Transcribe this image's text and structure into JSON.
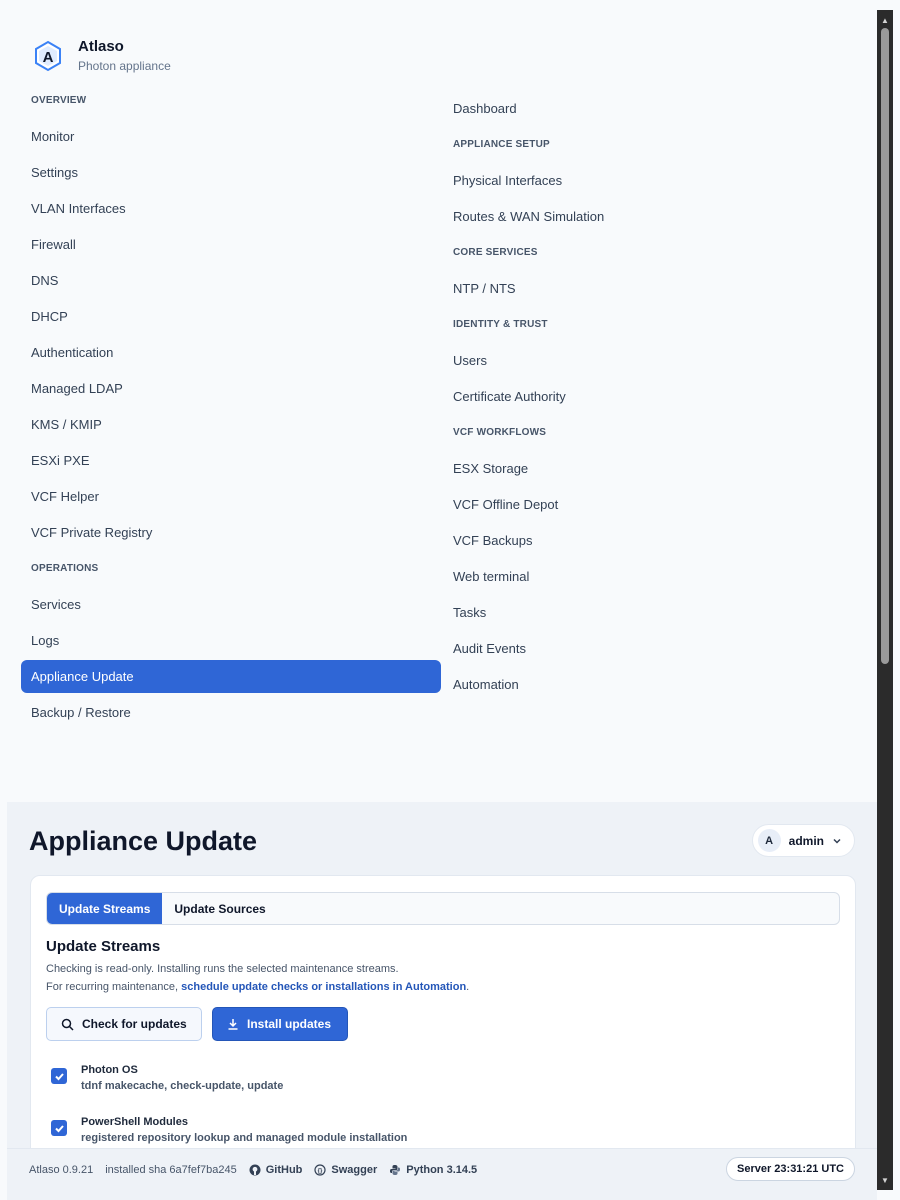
{
  "brand": {
    "name": "Atlaso",
    "subtitle": "Photon appliance",
    "logo_icon": "atlaso-logo-icon"
  },
  "nav_left": [
    {
      "type": "section",
      "label": "OVERVIEW"
    },
    {
      "type": "item",
      "label": "Monitor"
    },
    {
      "type": "item",
      "label": "Settings"
    },
    {
      "type": "item",
      "label": "VLAN Interfaces"
    },
    {
      "type": "item",
      "label": "Firewall"
    },
    {
      "type": "item",
      "label": "DNS"
    },
    {
      "type": "item",
      "label": "DHCP"
    },
    {
      "type": "item",
      "label": "Authentication"
    },
    {
      "type": "item",
      "label": "Managed LDAP"
    },
    {
      "type": "item",
      "label": "KMS / KMIP"
    },
    {
      "type": "item",
      "label": "ESXi PXE"
    },
    {
      "type": "item",
      "label": "VCF Helper"
    },
    {
      "type": "item",
      "label": "VCF Private Registry"
    },
    {
      "type": "section",
      "label": "OPERATIONS"
    },
    {
      "type": "item",
      "label": "Services"
    },
    {
      "type": "item",
      "label": "Logs"
    },
    {
      "type": "item",
      "label": "Appliance Update",
      "active": true
    },
    {
      "type": "item",
      "label": "Backup / Restore"
    }
  ],
  "nav_right": [
    {
      "type": "item",
      "label": "Dashboard"
    },
    {
      "type": "section",
      "label": "APPLIANCE SETUP"
    },
    {
      "type": "item",
      "label": "Physical Interfaces"
    },
    {
      "type": "item",
      "label": "Routes & WAN Simulation"
    },
    {
      "type": "section",
      "label": "CORE SERVICES"
    },
    {
      "type": "item",
      "label": "NTP / NTS"
    },
    {
      "type": "section",
      "label": "IDENTITY & TRUST"
    },
    {
      "type": "item",
      "label": "Users"
    },
    {
      "type": "item",
      "label": "Certificate Authority"
    },
    {
      "type": "section",
      "label": "VCF WORKFLOWS"
    },
    {
      "type": "item",
      "label": "ESX Storage"
    },
    {
      "type": "item",
      "label": "VCF Offline Depot"
    },
    {
      "type": "item",
      "label": "VCF Backups"
    },
    {
      "type": "item",
      "label": "Web terminal"
    },
    {
      "type": "item",
      "label": "Tasks"
    },
    {
      "type": "item",
      "label": "Audit Events"
    },
    {
      "type": "item",
      "label": "Automation"
    }
  ],
  "header": {
    "title": "Appliance Update",
    "user_initial": "A",
    "user_name": "admin"
  },
  "tabs": [
    {
      "label": "Update Streams",
      "active": true
    },
    {
      "label": "Update Sources",
      "active": false
    }
  ],
  "section": {
    "title": "Update Streams",
    "desc_line1": "Checking is read-only. Installing runs the selected maintenance streams.",
    "desc_line2_prefix": "For recurring maintenance, ",
    "desc_line2_link": "schedule update checks or installations in Automation",
    "desc_line2_suffix": "."
  },
  "buttons": {
    "check": "Check for updates",
    "install": "Install updates"
  },
  "streams": [
    {
      "name": "Photon OS",
      "desc": "tdnf makecache, check-update, update",
      "checked": true
    },
    {
      "name": "PowerShell Modules",
      "desc": "registered repository lookup and managed module installation",
      "checked": true
    }
  ],
  "footer": {
    "version": "Atlaso 0.9.21",
    "sha": "installed sha 6a7fef7ba245",
    "github": "GitHub",
    "swagger": "Swagger",
    "python": "Python 3.14.5",
    "server_time": "Server 23:31:21 UTC"
  },
  "colors": {
    "accent": "#2f66d6",
    "text": "#0f172a",
    "muted": "#475569"
  }
}
